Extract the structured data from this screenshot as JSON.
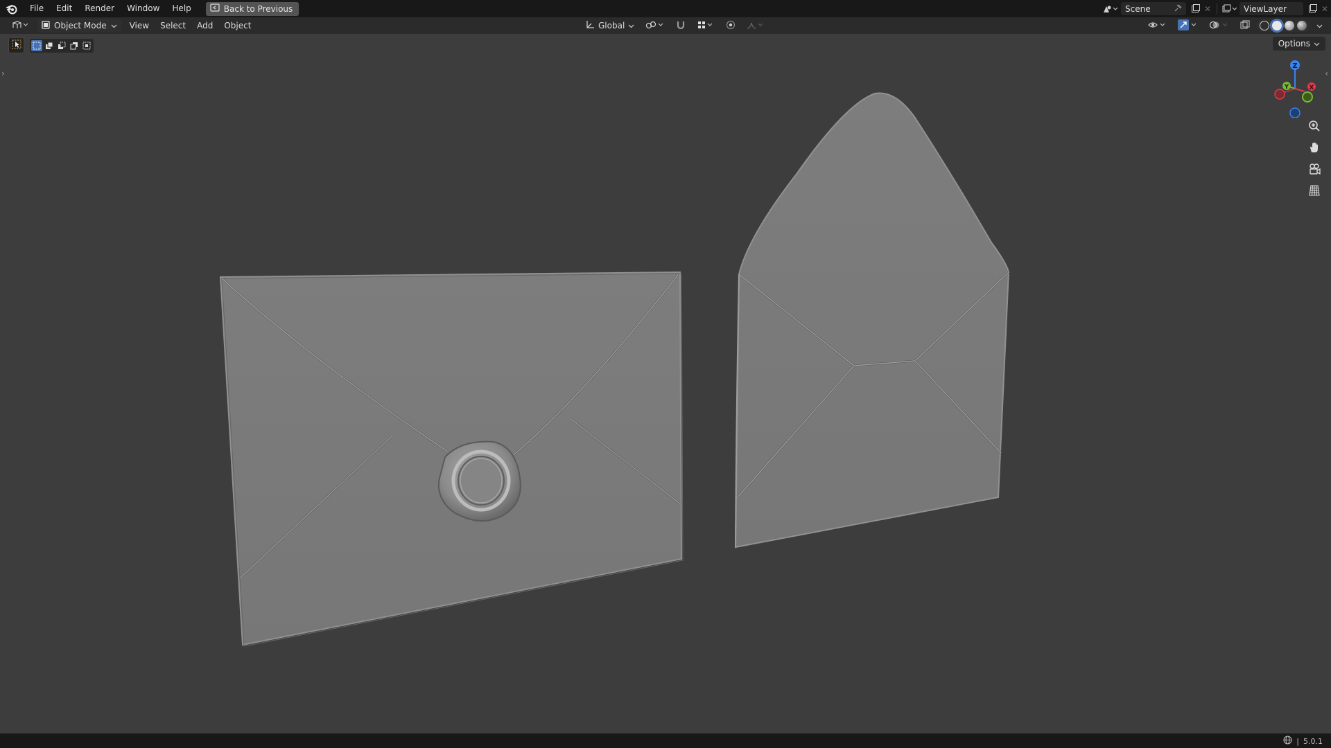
{
  "menu": {
    "items": [
      "File",
      "Edit",
      "Render",
      "Window",
      "Help"
    ],
    "back_button": "Back to Previous"
  },
  "topbar_right": {
    "scene_label": "Scene",
    "view_layer_label": "ViewLayer"
  },
  "viewport_header": {
    "mode": "Object Mode",
    "menus": [
      "View",
      "Select",
      "Add",
      "Object"
    ],
    "transform_orientation": "Global"
  },
  "options_label": "Options",
  "gizmo": {
    "axes": [
      "Z",
      "Y",
      "X"
    ],
    "colors": {
      "x": "#e0394a",
      "y": "#7ab836",
      "z": "#3b83f0"
    }
  },
  "status": {
    "version": "5.0.1"
  },
  "scene": {
    "objects": [
      "envelope-closed-with-wax-seal",
      "envelope-open-flap"
    ],
    "background": "#3d3d3d",
    "mesh_color": "#7a7a7a"
  }
}
